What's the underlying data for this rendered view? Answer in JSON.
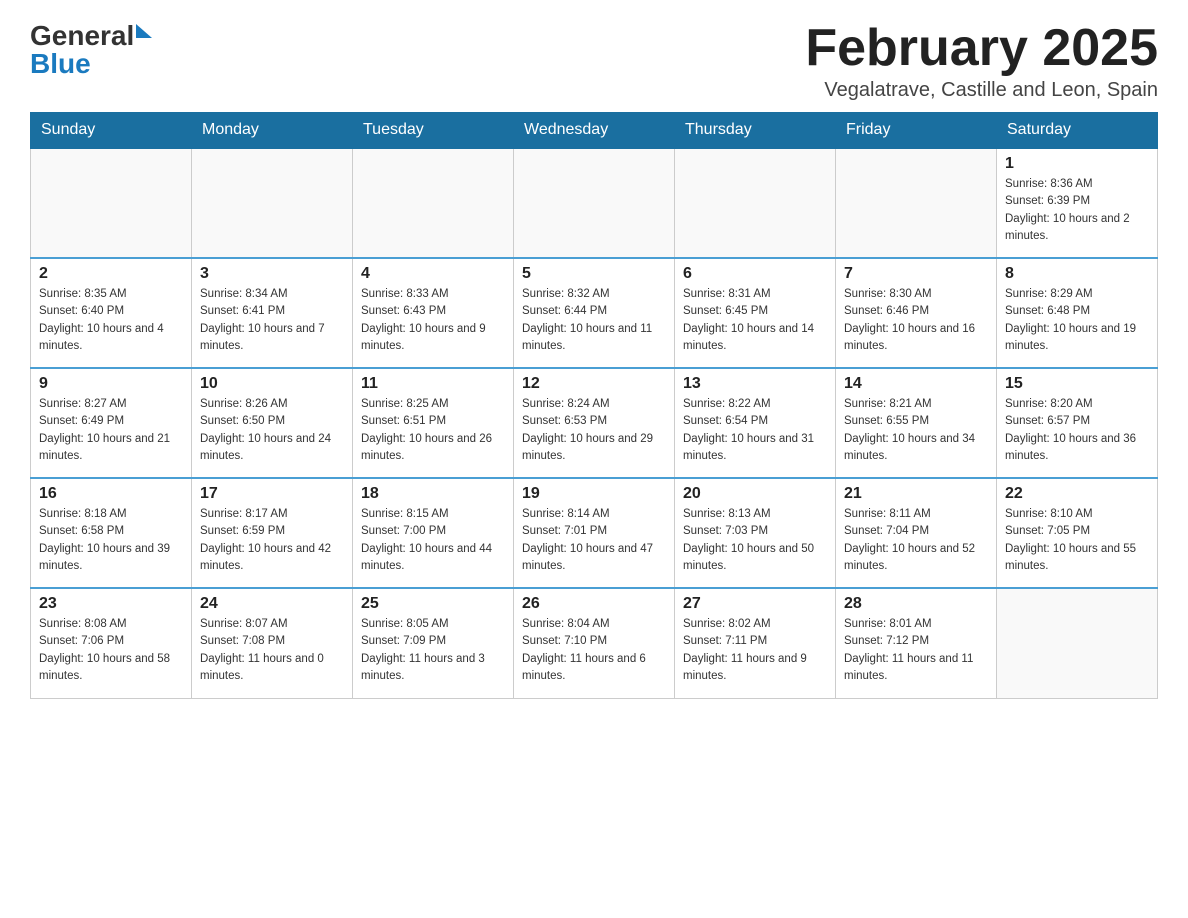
{
  "header": {
    "logo_general": "General",
    "logo_blue": "Blue",
    "month_title": "February 2025",
    "location": "Vegalatrave, Castille and Leon, Spain"
  },
  "days_of_week": [
    "Sunday",
    "Monday",
    "Tuesday",
    "Wednesday",
    "Thursday",
    "Friday",
    "Saturday"
  ],
  "weeks": [
    [
      {
        "day": "",
        "info": ""
      },
      {
        "day": "",
        "info": ""
      },
      {
        "day": "",
        "info": ""
      },
      {
        "day": "",
        "info": ""
      },
      {
        "day": "",
        "info": ""
      },
      {
        "day": "",
        "info": ""
      },
      {
        "day": "1",
        "info": "Sunrise: 8:36 AM\nSunset: 6:39 PM\nDaylight: 10 hours and 2 minutes."
      }
    ],
    [
      {
        "day": "2",
        "info": "Sunrise: 8:35 AM\nSunset: 6:40 PM\nDaylight: 10 hours and 4 minutes."
      },
      {
        "day": "3",
        "info": "Sunrise: 8:34 AM\nSunset: 6:41 PM\nDaylight: 10 hours and 7 minutes."
      },
      {
        "day": "4",
        "info": "Sunrise: 8:33 AM\nSunset: 6:43 PM\nDaylight: 10 hours and 9 minutes."
      },
      {
        "day": "5",
        "info": "Sunrise: 8:32 AM\nSunset: 6:44 PM\nDaylight: 10 hours and 11 minutes."
      },
      {
        "day": "6",
        "info": "Sunrise: 8:31 AM\nSunset: 6:45 PM\nDaylight: 10 hours and 14 minutes."
      },
      {
        "day": "7",
        "info": "Sunrise: 8:30 AM\nSunset: 6:46 PM\nDaylight: 10 hours and 16 minutes."
      },
      {
        "day": "8",
        "info": "Sunrise: 8:29 AM\nSunset: 6:48 PM\nDaylight: 10 hours and 19 minutes."
      }
    ],
    [
      {
        "day": "9",
        "info": "Sunrise: 8:27 AM\nSunset: 6:49 PM\nDaylight: 10 hours and 21 minutes."
      },
      {
        "day": "10",
        "info": "Sunrise: 8:26 AM\nSunset: 6:50 PM\nDaylight: 10 hours and 24 minutes."
      },
      {
        "day": "11",
        "info": "Sunrise: 8:25 AM\nSunset: 6:51 PM\nDaylight: 10 hours and 26 minutes."
      },
      {
        "day": "12",
        "info": "Sunrise: 8:24 AM\nSunset: 6:53 PM\nDaylight: 10 hours and 29 minutes."
      },
      {
        "day": "13",
        "info": "Sunrise: 8:22 AM\nSunset: 6:54 PM\nDaylight: 10 hours and 31 minutes."
      },
      {
        "day": "14",
        "info": "Sunrise: 8:21 AM\nSunset: 6:55 PM\nDaylight: 10 hours and 34 minutes."
      },
      {
        "day": "15",
        "info": "Sunrise: 8:20 AM\nSunset: 6:57 PM\nDaylight: 10 hours and 36 minutes."
      }
    ],
    [
      {
        "day": "16",
        "info": "Sunrise: 8:18 AM\nSunset: 6:58 PM\nDaylight: 10 hours and 39 minutes."
      },
      {
        "day": "17",
        "info": "Sunrise: 8:17 AM\nSunset: 6:59 PM\nDaylight: 10 hours and 42 minutes."
      },
      {
        "day": "18",
        "info": "Sunrise: 8:15 AM\nSunset: 7:00 PM\nDaylight: 10 hours and 44 minutes."
      },
      {
        "day": "19",
        "info": "Sunrise: 8:14 AM\nSunset: 7:01 PM\nDaylight: 10 hours and 47 minutes."
      },
      {
        "day": "20",
        "info": "Sunrise: 8:13 AM\nSunset: 7:03 PM\nDaylight: 10 hours and 50 minutes."
      },
      {
        "day": "21",
        "info": "Sunrise: 8:11 AM\nSunset: 7:04 PM\nDaylight: 10 hours and 52 minutes."
      },
      {
        "day": "22",
        "info": "Sunrise: 8:10 AM\nSunset: 7:05 PM\nDaylight: 10 hours and 55 minutes."
      }
    ],
    [
      {
        "day": "23",
        "info": "Sunrise: 8:08 AM\nSunset: 7:06 PM\nDaylight: 10 hours and 58 minutes."
      },
      {
        "day": "24",
        "info": "Sunrise: 8:07 AM\nSunset: 7:08 PM\nDaylight: 11 hours and 0 minutes."
      },
      {
        "day": "25",
        "info": "Sunrise: 8:05 AM\nSunset: 7:09 PM\nDaylight: 11 hours and 3 minutes."
      },
      {
        "day": "26",
        "info": "Sunrise: 8:04 AM\nSunset: 7:10 PM\nDaylight: 11 hours and 6 minutes."
      },
      {
        "day": "27",
        "info": "Sunrise: 8:02 AM\nSunset: 7:11 PM\nDaylight: 11 hours and 9 minutes."
      },
      {
        "day": "28",
        "info": "Sunrise: 8:01 AM\nSunset: 7:12 PM\nDaylight: 11 hours and 11 minutes."
      },
      {
        "day": "",
        "info": ""
      }
    ]
  ]
}
